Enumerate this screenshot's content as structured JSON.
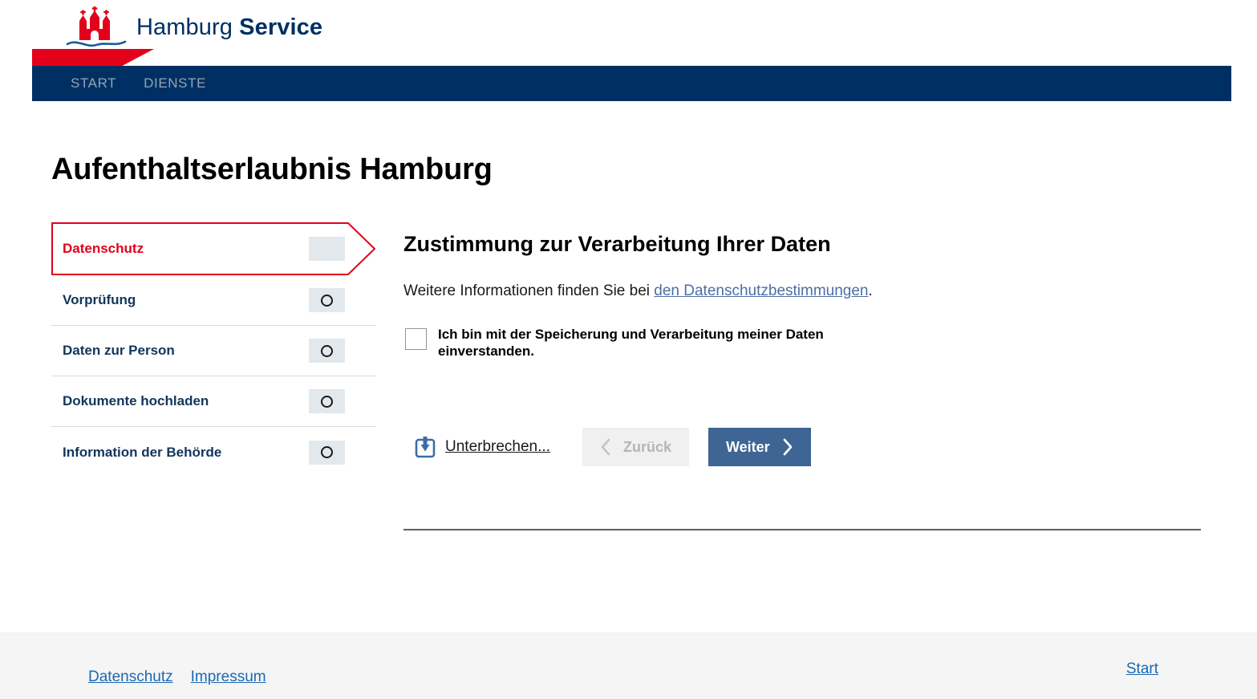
{
  "brand": {
    "name_light": "Hamburg",
    "name_bold": "Service",
    "crest_icon": "hamburg-coat-of-arms-icon",
    "colors": {
      "navy": "#003063",
      "red": "#e2001a",
      "link_blue": "#1b68b3",
      "button_blue": "#3e6593"
    }
  },
  "nav": {
    "items": [
      {
        "label": "START"
      },
      {
        "label": "DIENSTE"
      }
    ]
  },
  "page": {
    "title": "Aufenthaltserlaubnis Hamburg"
  },
  "steps": [
    {
      "label": "Datenschutz",
      "state": "active",
      "icon": ""
    },
    {
      "label": "Vorprüfung",
      "state": "pending",
      "icon": "circle-icon"
    },
    {
      "label": "Daten zur Person",
      "state": "pending",
      "icon": "circle-icon"
    },
    {
      "label": "Dokumente hochladen",
      "state": "pending",
      "icon": "circle-icon"
    },
    {
      "label": "Information der Behörde",
      "state": "pending",
      "icon": "circle-icon"
    }
  ],
  "main": {
    "heading": "Zustimmung zur Verarbeitung Ihrer Daten",
    "paragraph_before": "Weitere Informationen finden Sie bei ",
    "paragraph_link": "den Datenschutzbestimmungen",
    "paragraph_after": ".",
    "consent_label": "Ich bin mit der Speicherung und Verarbeitung meiner Daten einverstanden.",
    "consent_checked": false
  },
  "actions": {
    "interrupt_icon": "save-download-icon",
    "interrupt_label": "Unterbrechen...",
    "back_icon": "chevron-left-icon",
    "back_label": "Zurück",
    "back_disabled": true,
    "next_label": "Weiter",
    "next_icon": "chevron-right-icon"
  },
  "footer": {
    "links": [
      {
        "label": "Datenschutz"
      },
      {
        "label": "Impressum"
      }
    ],
    "start_label": "Start"
  }
}
